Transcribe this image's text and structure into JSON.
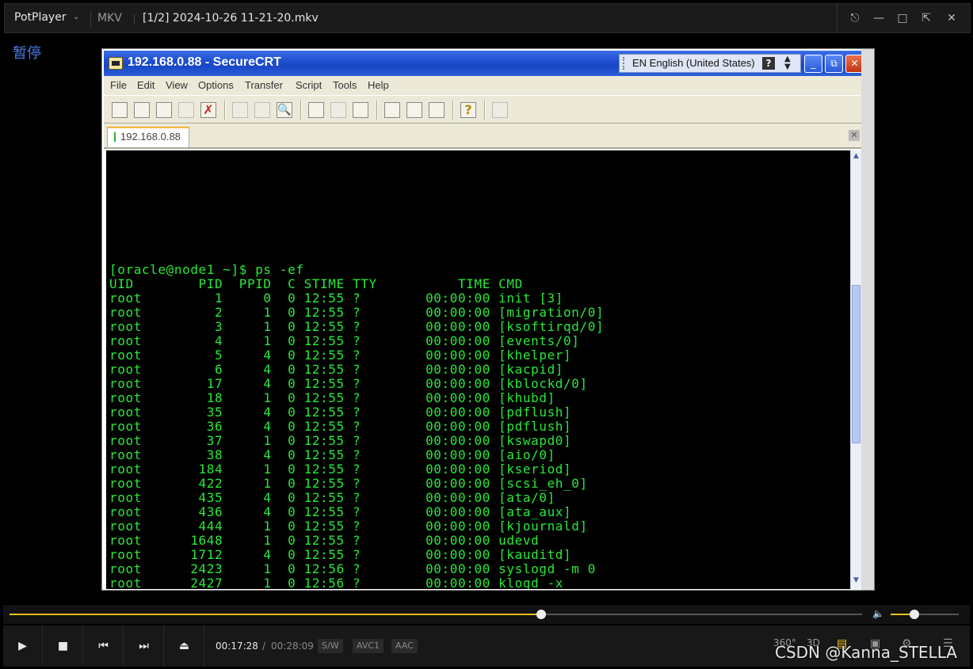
{
  "player": {
    "app_name": "PotPlayer",
    "format": "MKV",
    "file_title": "[1/2] 2024-10-26 11-21-20.mkv",
    "paused_label": "暂停",
    "current_time": "00:17:28",
    "time_sep": "/",
    "total_time": "00:28:09",
    "badges": [
      "S/W",
      "AVC1",
      "AAC"
    ],
    "right_icons": [
      "360°",
      "3D"
    ],
    "progress": 0.6236,
    "volume": 0.35,
    "accent_color": "#f2c118",
    "icons": {
      "pin": "pin-icon",
      "minimize": "minimize-icon",
      "maximize": "maximize-icon",
      "fullscreen": "fullscreen-icon",
      "close": "close-icon",
      "play": "play-icon",
      "stop": "stop-icon",
      "prev": "previous-icon",
      "next": "next-icon",
      "eject": "eject-icon",
      "volume": "volume-icon",
      "subtitle": "subtitle-icon",
      "chat": "chat-icon",
      "settings": "gear-icon",
      "menu": "menu-icon"
    }
  },
  "securecrt": {
    "title": "192.168.0.88 - SecureCRT",
    "language_bar": "EN English (United States)",
    "menu": [
      "File",
      "Edit",
      "View",
      "Options",
      "Transfer",
      "Script",
      "Tools",
      "Help"
    ],
    "session_tab": "192.168.0.88",
    "terminal_color": "#28e838",
    "terminal_lines": [
      "[oracle@node1 ~]$ ps -ef",
      "UID        PID  PPID  C STIME TTY          TIME CMD",
      "root         1     0  0 12:55 ?        00:00:00 init [3]",
      "root         2     1  0 12:55 ?        00:00:00 [migration/0]",
      "root         3     1  0 12:55 ?        00:00:00 [ksoftirqd/0]",
      "root         4     1  0 12:55 ?        00:00:00 [events/0]",
      "root         5     4  0 12:55 ?        00:00:00 [khelper]",
      "root         6     4  0 12:55 ?        00:00:00 [kacpid]",
      "root        17     4  0 12:55 ?        00:00:00 [kblockd/0]",
      "root        18     1  0 12:55 ?        00:00:00 [khubd]",
      "root        35     4  0 12:55 ?        00:00:00 [pdflush]",
      "root        36     4  0 12:55 ?        00:00:00 [pdflush]",
      "root        37     1  0 12:55 ?        00:00:00 [kswapd0]",
      "root        38     4  0 12:55 ?        00:00:00 [aio/0]",
      "root       184     1  0 12:55 ?        00:00:00 [kseriod]",
      "root       422     1  0 12:55 ?        00:00:00 [scsi_eh_0]",
      "root       435     4  0 12:55 ?        00:00:00 [ata/0]",
      "root       436     4  0 12:55 ?        00:00:00 [ata_aux]",
      "root       444     1  0 12:55 ?        00:00:00 [kjournald]",
      "root      1648     1  0 12:55 ?        00:00:00 udevd",
      "root      1712     4  0 12:55 ?        00:00:00 [kauditd]",
      "root      2423     1  0 12:56 ?        00:00:00 syslogd -m 0",
      "root      2427     1  0 12:56 ?        00:00:00 klogd -x"
    ]
  },
  "watermark": "CSDN @Kanna_STELLA"
}
